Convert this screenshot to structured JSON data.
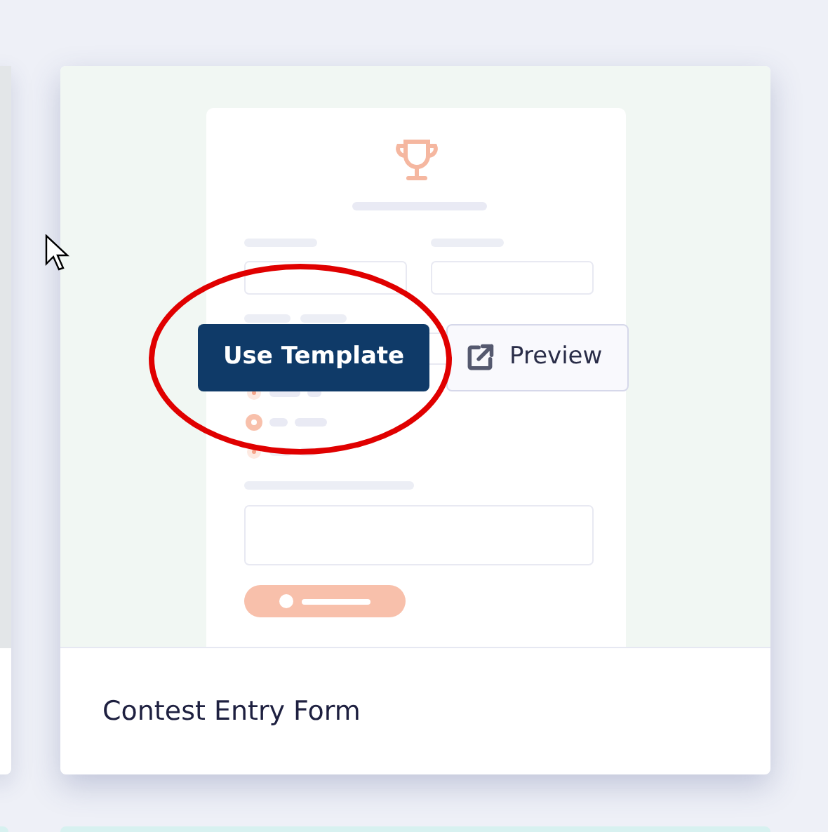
{
  "cards": [
    {
      "title": "Contest Entry Form",
      "actions": [
        {
          "label": "Use Template",
          "kind": "primary"
        },
        {
          "label": "Preview",
          "kind": "secondary"
        }
      ]
    }
  ]
}
